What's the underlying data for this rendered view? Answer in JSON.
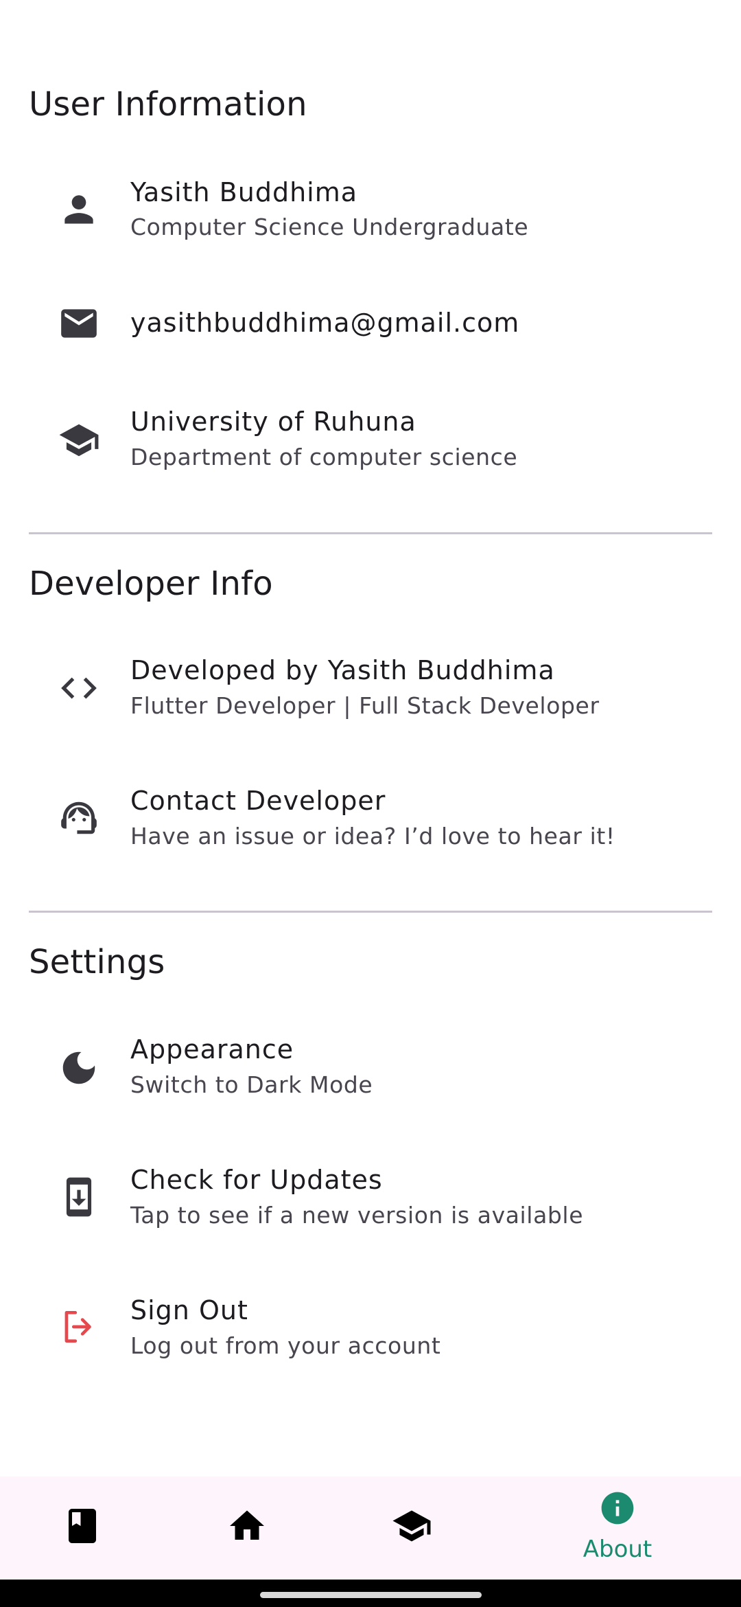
{
  "sections": {
    "user_info": {
      "title": "User Information",
      "items": [
        {
          "icon": "person-icon",
          "title": "Yasith Buddhima",
          "subtitle": "Computer Science Undergraduate"
        },
        {
          "icon": "mail-icon",
          "title": "yasithbuddhima@gmail.com"
        },
        {
          "icon": "school-icon",
          "title": "University of Ruhuna",
          "subtitle": "Department of computer science"
        }
      ]
    },
    "developer_info": {
      "title": "Developer Info",
      "items": [
        {
          "icon": "code-icon",
          "title": "Developed by Yasith Buddhima",
          "subtitle": "Flutter Developer | Full Stack Developer"
        },
        {
          "icon": "support-agent-icon",
          "title": "Contact Developer",
          "subtitle": "Have an issue or idea? I’d love to hear it!"
        }
      ]
    },
    "settings": {
      "title": "Settings",
      "items": [
        {
          "icon": "dark-mode-icon",
          "title": "Appearance",
          "subtitle": "Switch to Dark Mode"
        },
        {
          "icon": "system-update-icon",
          "title": "Check for Updates",
          "subtitle": "Tap to see if a new version is available"
        },
        {
          "icon": "logout-icon",
          "title": "Sign Out",
          "subtitle": "Log out from your account"
        }
      ]
    }
  },
  "bottom_nav": {
    "items": [
      {
        "icon": "book-icon",
        "label": ""
      },
      {
        "icon": "home-icon",
        "label": ""
      },
      {
        "icon": "school-icon",
        "label": ""
      },
      {
        "icon": "info-icon",
        "label": "About",
        "active": true
      }
    ]
  },
  "colors": {
    "accent": "#1b8a6f",
    "signout": "#e5484d",
    "icon": "#3a3940",
    "nav_background": "#fdf5fb"
  }
}
